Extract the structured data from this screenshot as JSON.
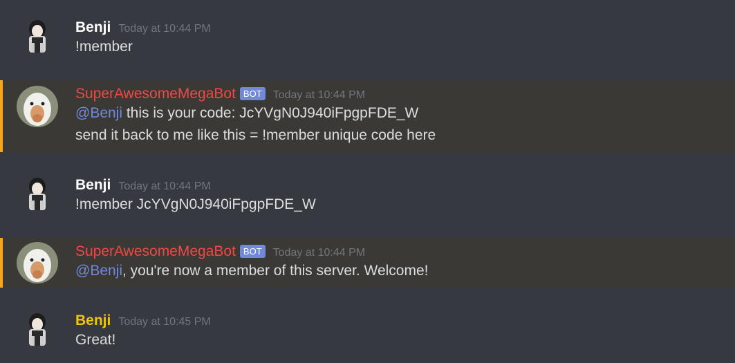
{
  "messages": [
    {
      "author": "Benji",
      "timestamp": "Today at 10:44 PM",
      "lines": [
        {
          "text": "!member"
        }
      ]
    },
    {
      "author": "SuperAwesomeMegaBot",
      "bot_tag": "BOT",
      "timestamp": "Today at 10:44 PM",
      "lines": [
        {
          "mention": "@Benji",
          "text": " this is your code: JcYVgN0J940iFpgpFDE_W"
        },
        {
          "text": "send it back to me like this = !member unique code here"
        }
      ]
    },
    {
      "author": "Benji",
      "timestamp": "Today at 10:44 PM",
      "lines": [
        {
          "text": "!member JcYVgN0J940iFpgpFDE_W"
        }
      ]
    },
    {
      "author": "SuperAwesomeMegaBot",
      "bot_tag": "BOT",
      "timestamp": "Today at 10:44 PM",
      "lines": [
        {
          "mention": "@Benji",
          "text": ", you're now a member of this server. Welcome!"
        }
      ]
    },
    {
      "author": "Benji",
      "timestamp": "Today at 10:45 PM",
      "lines": [
        {
          "text": "Great!"
        }
      ]
    }
  ],
  "colors": {
    "background": "#36393f",
    "mention_highlight_bg": "#3a3935",
    "mention_highlight_border": "#faa61a",
    "bot_name": "#f04747",
    "bot_tag_bg": "#7289da",
    "mention": "#7289da",
    "gold_name": "#f1c40f",
    "timestamp": "#72767d",
    "text": "#dcddde"
  },
  "icons": {
    "user_avatar": "anime-character-avatar",
    "bot_avatar": "goose-avatar"
  }
}
